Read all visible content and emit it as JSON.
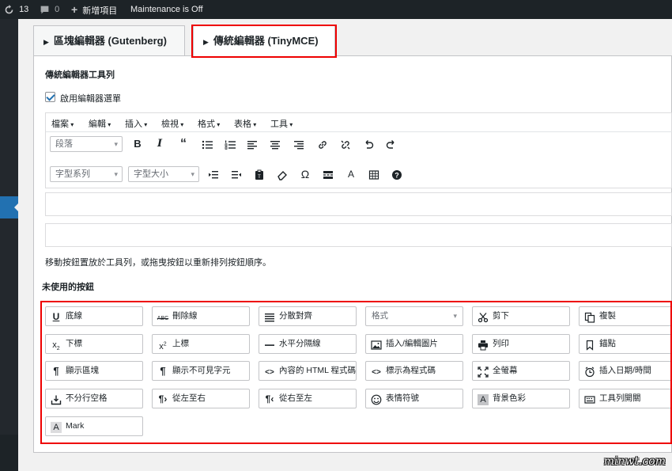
{
  "adminbar": {
    "updates_count": "13",
    "comments_count": "0",
    "new_label": "新增項目",
    "maintenance": "Maintenance is Off"
  },
  "tabs": {
    "gutenberg": "區塊編輯器 (Gutenberg)",
    "tinymce": "傳統編輯器 (TinyMCE)"
  },
  "section_title": "傳統編輯器工具列",
  "enable_menu_label": "啟用編輯器選單",
  "menubar": [
    "檔案",
    "編輯",
    "插入",
    "檢視",
    "格式",
    "表格",
    "工具"
  ],
  "toolbar1": {
    "format_select": "段落",
    "icons": [
      "bold-icon",
      "italic-icon",
      "blockquote-icon",
      "bullet-list-icon",
      "numbered-list-icon",
      "align-left-icon",
      "align-center-icon",
      "align-right-icon",
      "link-icon",
      "unlink-icon",
      "undo-icon",
      "redo-icon"
    ]
  },
  "toolbar2": {
    "font_family": "字型系列",
    "font_size": "字型大小",
    "icons": [
      "indent-icon",
      "outdent-icon",
      "paste-text-icon",
      "clear-formatting-icon",
      "special-character-icon",
      "read-more-icon",
      "text-color-icon",
      "table-icon",
      "help-icon"
    ]
  },
  "hint": "移動按鈕置放於工具列，或拖曳按鈕以重新排列按鈕順序。",
  "unused_title": "未使用的按鈕",
  "unused_buttons": [
    {
      "label": "底線",
      "icon": "underline-icon"
    },
    {
      "label": "刪除線",
      "icon": "strikethrough-icon"
    },
    {
      "label": "分散對齊",
      "icon": "justify-icon"
    },
    {
      "label": "格式",
      "icon": "",
      "select": true
    },
    {
      "label": "剪下",
      "icon": "cut-icon"
    },
    {
      "label": "複製",
      "icon": "copy-icon"
    },
    {
      "label": "下標",
      "icon": "subscript-icon"
    },
    {
      "label": "上標",
      "icon": "superscript-icon"
    },
    {
      "label": "水平分隔線",
      "icon": "horizontal-rule-icon"
    },
    {
      "label": "插入/編輯圖片",
      "icon": "image-icon"
    },
    {
      "label": "列印",
      "icon": "print-icon"
    },
    {
      "label": "錨點",
      "icon": "anchor-icon"
    },
    {
      "label": "顯示區塊",
      "icon": "pilcrow-icon"
    },
    {
      "label": "顯示不可見字元",
      "icon": "pilcrow-icon"
    },
    {
      "label": "內容的 HTML 程式碼",
      "icon": "code-icon"
    },
    {
      "label": "標示為程式碼",
      "icon": "code-icon"
    },
    {
      "label": "全螢幕",
      "icon": "fullscreen-icon"
    },
    {
      "label": "插入日期/時間",
      "icon": "clock-icon"
    },
    {
      "label": "不分行空格",
      "icon": "nbsp-icon"
    },
    {
      "label": "從左至右",
      "icon": "ltr-icon"
    },
    {
      "label": "從右至左",
      "icon": "rtl-icon"
    },
    {
      "label": "表情符號",
      "icon": "emoji-icon"
    },
    {
      "label": "背景色彩",
      "icon": "background-color-icon"
    },
    {
      "label": "工具列開關",
      "icon": "toolbar-toggle-icon"
    },
    {
      "label": "Mark",
      "icon": "mark-icon"
    }
  ],
  "watermark": "minwt.com",
  "colors": {
    "highlight": "#e00000",
    "accent": "#2271b1",
    "adminbar": "#1d2327"
  }
}
